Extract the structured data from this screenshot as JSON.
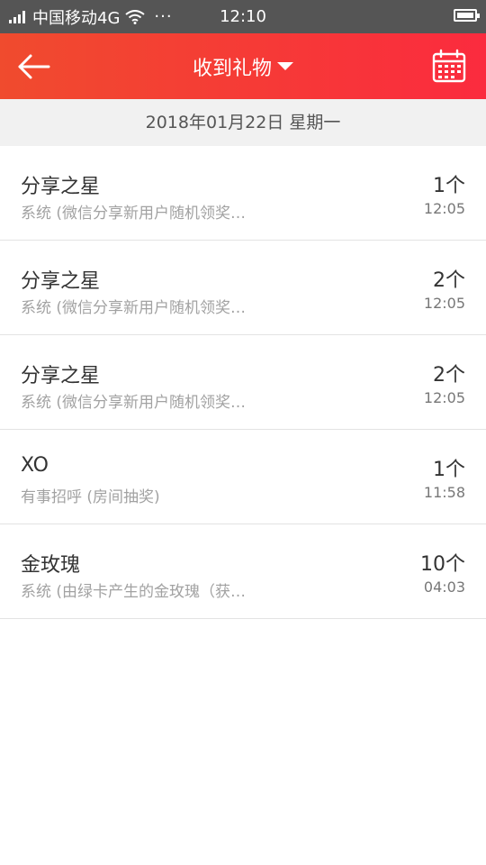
{
  "status_bar": {
    "carrier": "中国移动4G",
    "dots": "···",
    "time": "12:10"
  },
  "nav": {
    "title": "收到礼物"
  },
  "date_header": "2018年01月22日 星期一",
  "items": [
    {
      "title": "分享之星",
      "desc": "系统 (微信分享新用户随机领奖…",
      "count": "1个",
      "time": "12:05"
    },
    {
      "title": "分享之星",
      "desc": "系统 (微信分享新用户随机领奖…",
      "count": "2个",
      "time": "12:05"
    },
    {
      "title": "分享之星",
      "desc": "系统 (微信分享新用户随机领奖…",
      "count": "2个",
      "time": "12:05"
    },
    {
      "title": "XO",
      "desc": "有事招呼 (房间抽奖)",
      "count": "1个",
      "time": "11:58"
    },
    {
      "title": "金玫瑰",
      "desc": "系统 (由绿卡产生的金玫瑰（获…",
      "count": "10个",
      "time": "04:03"
    }
  ],
  "colors": {
    "accent_start": "#f04b2e",
    "accent_end": "#fb2b3e"
  }
}
